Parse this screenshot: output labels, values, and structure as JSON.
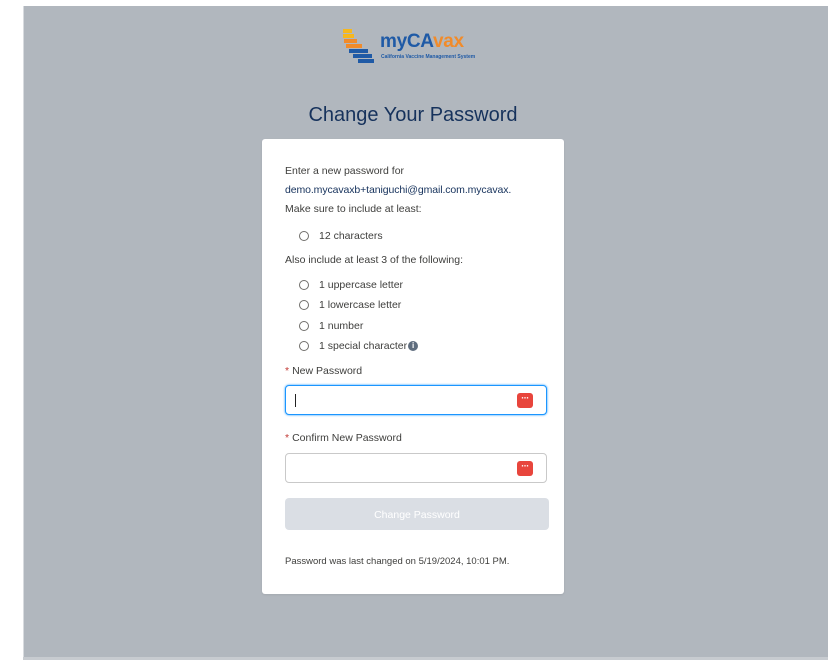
{
  "logo": {
    "word_part1": "my",
    "word_part2": "CA",
    "word_part3": "vax",
    "subtitle": "California Vaccine Management System",
    "colors": {
      "blue": "#1f5aa6",
      "orange": "#f18b2a",
      "yellow": "#f6b81e"
    }
  },
  "page_title": "Change Your Password",
  "card": {
    "intro": "Enter a new password for",
    "username": "demo.mycavaxb+taniguchi@gmail.com.mycavax.",
    "include_at_least": "Make sure to include at least:",
    "primary_requirement": "12 characters",
    "also_include": "Also include at least 3 of the following:",
    "requirements": [
      "1 uppercase letter",
      "1 lowercase letter",
      "1 number",
      "1 special character"
    ],
    "info_icon": "info-icon",
    "new_password_label": "New Password",
    "confirm_password_label": "Confirm New Password",
    "required_marker": "*",
    "new_password_value": "",
    "confirm_password_value": "",
    "submit_label": "Change Password",
    "last_changed": "Password was last changed on 5/19/2024, 10:01 PM."
  },
  "colors": {
    "background": "#b1b7be",
    "title": "#16325c",
    "focus": "#1b96ff",
    "required": "#c23934",
    "button_disabled": "#dadee4",
    "password_icon": "#e8453c"
  }
}
